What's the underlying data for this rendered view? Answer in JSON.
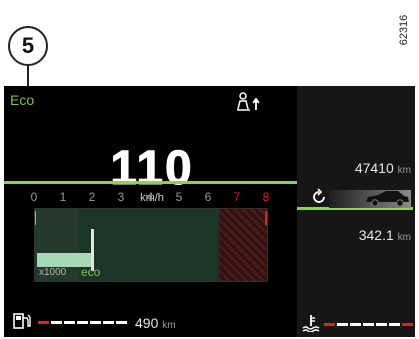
{
  "figure": {
    "id": "62316",
    "callout": "5"
  },
  "status": {
    "drive_mode": "Eco"
  },
  "speed": {
    "value": "110",
    "unit": "km/h"
  },
  "tachometer": {
    "scale": [
      "0",
      "1",
      "2",
      "3",
      "4",
      "5",
      "6",
      "7",
      "8"
    ],
    "redline_from": "7",
    "multiplier": "x1000",
    "eco_label": "eco",
    "current_rpm_x1000": 1.9
  },
  "fuel": {
    "range_value": "490",
    "range_unit": "km",
    "level_fraction": 0.6
  },
  "odometer": {
    "value": "47410",
    "unit": "km"
  },
  "trip": {
    "value": "342.1",
    "unit": "km"
  },
  "coolant": {
    "level_fraction": 0.5
  },
  "colors": {
    "accent_green": "#8fd14f",
    "warning_red": "#e0202a",
    "background": "#000000"
  },
  "icons": [
    "driver-position-icon",
    "fuel-pump-icon",
    "trip-reset-icon",
    "car-icon",
    "coolant-temperature-icon"
  ]
}
